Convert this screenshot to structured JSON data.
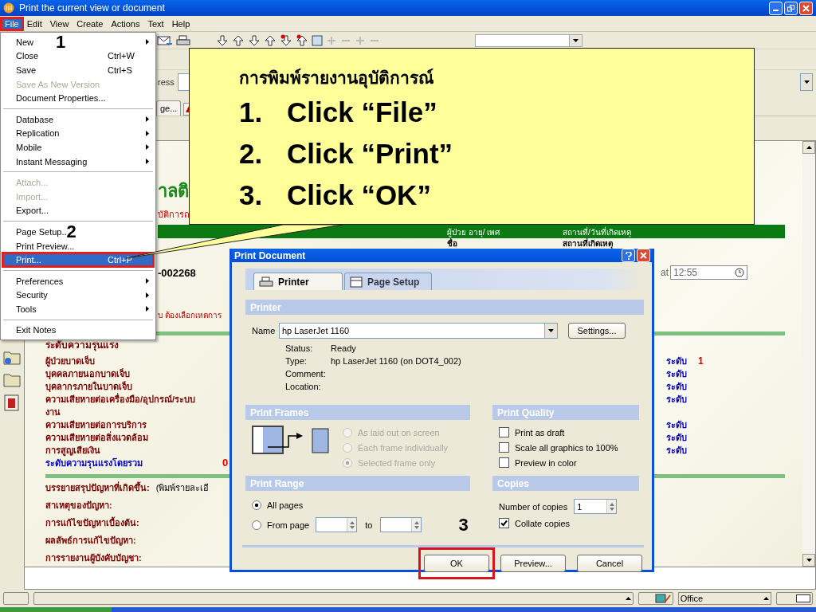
{
  "window": {
    "title": "Print the current view or document"
  },
  "menu_bar": [
    {
      "label": "File",
      "selected": true,
      "annotated": true
    },
    {
      "label": "Edit",
      "selected": false,
      "annotated": false
    },
    {
      "label": "View",
      "selected": false,
      "annotated": false
    },
    {
      "label": "Create",
      "selected": false,
      "annotated": false
    },
    {
      "label": "Actions",
      "selected": false,
      "annotated": false
    },
    {
      "label": "Text",
      "selected": false,
      "annotated": false
    },
    {
      "label": "Help",
      "selected": false,
      "annotated": false
    }
  ],
  "file_menu": {
    "groups": [
      [
        {
          "label": "New",
          "step": "1",
          "submenu": true,
          "disabled": false,
          "selected": false,
          "annotated": false
        },
        {
          "label": "Close",
          "shortcut": "Ctrl+W",
          "submenu": false,
          "disabled": false,
          "selected": false,
          "annotated": false
        },
        {
          "label": "Save",
          "shortcut": "Ctrl+S",
          "submenu": false,
          "disabled": false,
          "selected": false,
          "annotated": false
        },
        {
          "label": "Save As New Version",
          "submenu": false,
          "disabled": true,
          "selected": false,
          "annotated": false
        },
        {
          "label": "Document Properties...",
          "submenu": false,
          "disabled": false,
          "selected": false,
          "annotated": false
        }
      ],
      [
        {
          "label": "Database",
          "submenu": true,
          "disabled": false,
          "selected": false,
          "annotated": false
        },
        {
          "label": "Replication",
          "submenu": true,
          "disabled": false,
          "selected": false,
          "annotated": false
        },
        {
          "label": "Mobile",
          "submenu": true,
          "disabled": false,
          "selected": false,
          "annotated": false
        },
        {
          "label": "Instant Messaging",
          "submenu": true,
          "disabled": false,
          "selected": false,
          "annotated": false
        }
      ],
      [
        {
          "label": "Attach...",
          "submenu": false,
          "disabled": true,
          "selected": false,
          "annotated": false
        },
        {
          "label": "Import...",
          "submenu": false,
          "disabled": true,
          "selected": false,
          "annotated": false
        },
        {
          "label": "Export...",
          "submenu": false,
          "disabled": false,
          "selected": false,
          "annotated": false
        }
      ],
      [
        {
          "label": "Page Setup..",
          "step": "2",
          "submenu": false,
          "disabled": false,
          "selected": false,
          "annotated": false
        },
        {
          "label": "Print Preview...",
          "submenu": false,
          "disabled": false,
          "selected": false,
          "annotated": false
        },
        {
          "label": "Print...",
          "shortcut": "Ctrl+P",
          "submenu": false,
          "disabled": false,
          "selected": true,
          "annotated": true
        }
      ],
      [
        {
          "label": "Preferences",
          "submenu": true,
          "disabled": false,
          "selected": false,
          "annotated": false
        },
        {
          "label": "Security",
          "submenu": true,
          "disabled": false,
          "selected": false,
          "annotated": false
        },
        {
          "label": "Tools",
          "submenu": true,
          "disabled": false,
          "selected": false,
          "annotated": false
        }
      ],
      [
        {
          "label": "Exit Notes",
          "submenu": false,
          "disabled": false,
          "selected": false,
          "annotated": false
        }
      ]
    ]
  },
  "address": {
    "label": "ress"
  },
  "doc_tabs": [
    {
      "label": "ge..."
    }
  ],
  "callout": {
    "title": "การพิมพ์รายงานอุบัติการณ์",
    "steps": [
      {
        "number": "1.",
        "text": "Click “File”"
      },
      {
        "number": "2.",
        "text": "Click “Print”"
      },
      {
        "number": "3.",
        "text": "Click “OK”"
      }
    ]
  },
  "document": {
    "heading": "าลติ",
    "subheading": "บัติการถ",
    "header_bar": [
      "ผู้ป่วย  อายุ/ เพศ",
      "สถานที่/วันที่เกิดเหตุ"
    ],
    "fields_row": [
      "ชื่อ",
      "สถานที่เกิดเหตุ"
    ],
    "report_no": "-002268",
    "time_label": "at",
    "time_value": "12:55",
    "warning": "บ ต้องเลือกเหตการ",
    "severity_title": "ระดับความรุนแรง",
    "severity_rows": [
      {
        "label": "ผู้ป่วยบาดเจ็บ",
        "level_label": "ระดับ",
        "level_value": "1"
      },
      {
        "label": "บุคคลภายนอกบาดเจ็บ",
        "level_label": "ระดับ"
      },
      {
        "label": "บุคลากรภายในบาดเจ็บ",
        "level_label": "ระดับ"
      },
      {
        "label": "ความเสียหายต่อเครื่องมือ/อุปกรณ์/ระบบ",
        "level_label": "ระดับ"
      },
      {
        "label": "งาน"
      },
      {
        "label": "ความเสียหายต่อการบริการ",
        "level_label": "ระดับ"
      },
      {
        "label": "ความเสียหายต่อสิ่งแวดล้อม",
        "level_label": "ระดับ"
      },
      {
        "label": "การสูญเสียเงิน",
        "level_label": "ระดับ"
      }
    ],
    "overall": {
      "label": "ระดับความรุนแรงโดยรวม",
      "value": "0"
    },
    "narrative": [
      {
        "label": "บรรยายสรุปปัญหาที่เกิดขึ้น:",
        "value": "(พิมพ์รายละเอี"
      },
      {
        "label": "สาเหตุของปัญหา:"
      },
      {
        "label": "การแก้ไขปัญหาเบื้องต้น:"
      },
      {
        "label": "ผลลัพธ์การแก้ไขปัญหา:"
      },
      {
        "label": "การรายงานผู้บังคับบัญชา:"
      }
    ]
  },
  "dialog": {
    "title": "Print Document",
    "tabs": [
      {
        "label": "Printer",
        "selected": true
      },
      {
        "label": "Page Setup",
        "selected": false
      }
    ],
    "printer": {
      "heading": "Printer",
      "name_label": "Name",
      "name_value": "hp LaserJet 1160",
      "settings_button": "Settings...",
      "info": [
        {
          "label": "Status:",
          "value": "Ready"
        },
        {
          "label": "Type:",
          "value": "hp LaserJet 1160 (on DOT4_002)"
        },
        {
          "label": "Comment:"
        },
        {
          "label": "Location:"
        }
      ]
    },
    "print_frames": {
      "heading": "Print Frames",
      "options": [
        {
          "label": "As laid out on screen",
          "selected": false,
          "disabled": true
        },
        {
          "label": "Each frame individually",
          "selected": false,
          "disabled": true
        },
        {
          "label": "Selected frame only",
          "selected": true,
          "disabled": true
        }
      ]
    },
    "print_quality": {
      "heading": "Print Quality",
      "options": [
        {
          "label": "Print as draft",
          "checked": false
        },
        {
          "label": "Scale all graphics to 100%",
          "checked": false
        },
        {
          "label": "Preview in color",
          "checked": false
        }
      ]
    },
    "print_range": {
      "heading": "Print Range",
      "options": [
        {
          "label": "All pages",
          "selected": true
        },
        {
          "label": "From page",
          "selected": false
        }
      ],
      "to_label": "to",
      "step": "3"
    },
    "copies": {
      "heading": "Copies",
      "count_label": "Number of copies",
      "count_value": "1",
      "collate": {
        "label": "Collate copies",
        "checked": true
      }
    },
    "buttons": [
      {
        "label": "OK",
        "annotated": true
      },
      {
        "label": "Preview...",
        "annotated": false
      },
      {
        "label": "Cancel",
        "annotated": false
      }
    ]
  },
  "status_bar": {
    "location": "Office"
  }
}
